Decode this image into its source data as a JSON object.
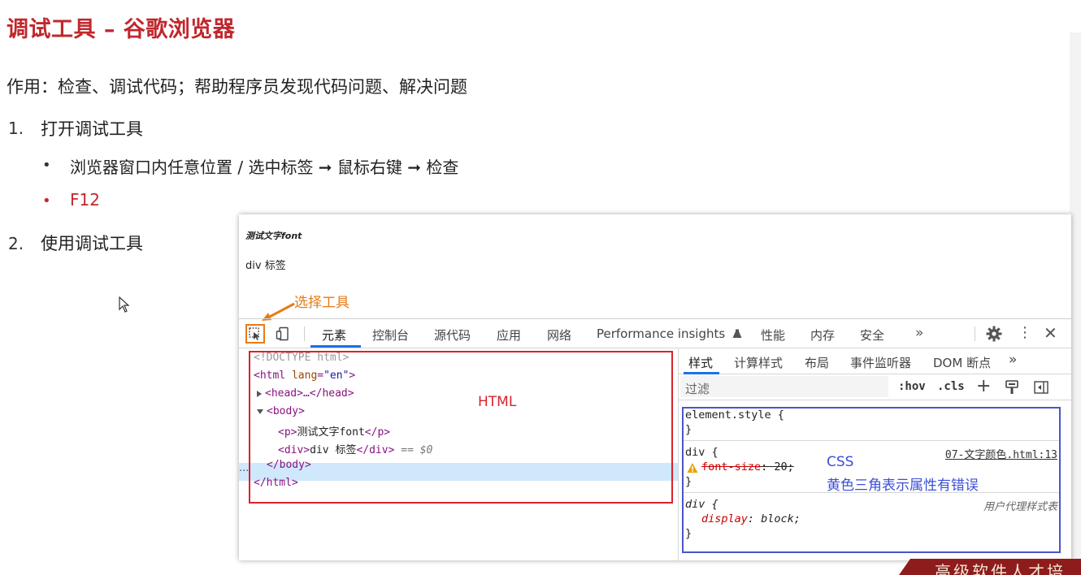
{
  "slide": {
    "title": "调试工具 – 谷歌浏览器",
    "purpose": "作用：检查、调试代码；帮助程序员发现代码问题、解决问题",
    "steps": [
      {
        "number": "1.",
        "label": "打开调试工具"
      },
      {
        "number": "2.",
        "label": "使用调试工具"
      }
    ],
    "bullets": [
      {
        "marker": "•",
        "text": "浏览器窗口内任意位置 / 选中标签 ➞ 鼠标右键 ➞ 检查"
      },
      {
        "marker": "•",
        "text": "F12"
      }
    ],
    "banner": "高级软件人才培"
  },
  "page_preview": {
    "p_text": "测试文字font",
    "div_text": "div 标签"
  },
  "annotations": {
    "select_tool": "选择工具",
    "html": "HTML",
    "css": "CSS",
    "css_desc": "黄色三角表示属性有错误"
  },
  "devtools": {
    "tabs": [
      "元素",
      "控制台",
      "源代码",
      "应用",
      "网络",
      "Performance insights",
      "性能",
      "内存",
      "安全"
    ],
    "more": "»",
    "elements": {
      "doctype": "<!DOCTYPE html>",
      "html_open_tag": "<html",
      "html_lang_attr": "lang",
      "html_lang_value": "\"en\"",
      "html_open_end": ">",
      "head": "<head>…</head>",
      "body_open": "<body>",
      "p_open": "<p>",
      "p_text": "测试文字font",
      "p_close": "</p>",
      "div_open": "<div>",
      "div_text": "div 标签",
      "div_close": "</div>",
      "selected_marker": "== $0",
      "row_dots": "···",
      "body_close": "</body>",
      "html_close": "</html>"
    },
    "styles": {
      "subtabs": [
        "样式",
        "计算样式",
        "布局",
        "事件监听器",
        "DOM 断点"
      ],
      "more": "»",
      "filter_placeholder": "过滤",
      "hov": ":hov",
      "cls": ".cls",
      "plus": "+",
      "element_style_open": "element.style {",
      "rule_close": "}",
      "div_rule_open": "div {",
      "source_file": "07-文字颜色.html:13",
      "bad_property": "font-size",
      "bad_value": ": 20;",
      "ua_label": "用户代理样式表",
      "display_property": "display",
      "display_value": ": block;"
    }
  },
  "colors": {
    "title_red": "#c0282d",
    "select_orange": "#e57b19",
    "html_box_red": "#d9232d",
    "css_box_blue": "#4a55c8",
    "active_tab_blue": "#1a73e8",
    "selected_row": "#cfe8fc"
  }
}
